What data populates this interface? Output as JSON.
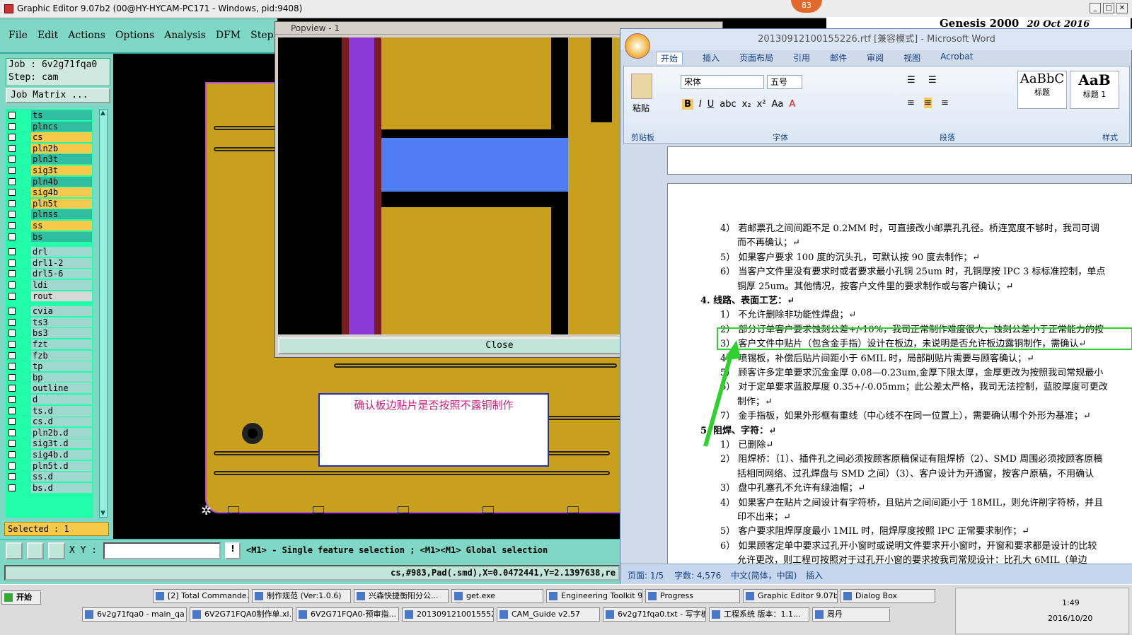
{
  "title": "Graphic Editor 9.07b2 (00@HY-HYCAM-PC171 - Windows, pid:9408)",
  "badge": "83",
  "genesis": {
    "name": "Genesis 2000",
    "date": "20 Oct 2016"
  },
  "menu": [
    "File",
    "Edit",
    "Actions",
    "Options",
    "Analysis",
    "DFM",
    "Step"
  ],
  "job": {
    "job": "Job : 6v2g71fqa0",
    "step": "Step: cam",
    "matrix": "Job Matrix ..."
  },
  "layers": [
    {
      "name": "ts",
      "color": "#2fbfa0"
    },
    {
      "name": "plncs",
      "color": "#2fbfa0"
    },
    {
      "name": "cs",
      "color": "#f5c94a"
    },
    {
      "name": "pln2b",
      "color": "#f5c94a"
    },
    {
      "name": "pln3t",
      "color": "#2fbfa0"
    },
    {
      "name": "sig3t",
      "color": "#f5c94a"
    },
    {
      "name": "pln4b",
      "color": "#2fbfa0"
    },
    {
      "name": "sig4b",
      "color": "#f5c94a"
    },
    {
      "name": "pln5t",
      "color": "#f5c94a"
    },
    {
      "name": "plnss",
      "color": "#2fbfa0"
    },
    {
      "name": "ss",
      "color": "#f5c94a"
    },
    {
      "name": "bs",
      "color": "#2fbfa0"
    },
    {
      "name": "drl",
      "color": "#9ed8cf"
    },
    {
      "name": "drl1-2",
      "color": "#9ed8cf"
    },
    {
      "name": "drl5-6",
      "color": "#9ed8cf"
    },
    {
      "name": "ldi",
      "color": "#9ed8cf"
    },
    {
      "name": "rout",
      "color": "#d8d8d8"
    },
    {
      "name": "cvia",
      "color": "#9ed8cf"
    },
    {
      "name": "ts3",
      "color": "#9ed8cf"
    },
    {
      "name": "bs3",
      "color": "#9ed8cf"
    },
    {
      "name": "fzt",
      "color": "#9ed8cf"
    },
    {
      "name": "fzb",
      "color": "#9ed8cf"
    },
    {
      "name": "tp",
      "color": "#9ed8cf"
    },
    {
      "name": "bp",
      "color": "#9ed8cf"
    },
    {
      "name": "outline",
      "color": "#9ed8cf"
    },
    {
      "name": "d",
      "color": "#9ed8cf"
    },
    {
      "name": "ts.d",
      "color": "#9ed8cf"
    },
    {
      "name": "cs.d",
      "color": "#9ed8cf"
    },
    {
      "name": "pln2b.d",
      "color": "#9ed8cf"
    },
    {
      "name": "sig3t.d",
      "color": "#9ed8cf"
    },
    {
      "name": "sig4b.d",
      "color": "#9ed8cf"
    },
    {
      "name": "pln5t.d",
      "color": "#9ed8cf"
    },
    {
      "name": "ss.d",
      "color": "#9ed8cf"
    },
    {
      "name": "bs.d",
      "color": "#9ed8cf"
    }
  ],
  "selected": "Selected : 1",
  "xy_label": "X Y :",
  "hint": "<M1> - Single feature selection ; <M1><M1> Global selection",
  "status": "cs,#983,Pad(.smd),X=0.0472441,Y=2.1397638,re",
  "popview": {
    "title": "Popview - 1",
    "close": "Close"
  },
  "note": "确认板边贴片是否按照不露铜制作",
  "word": {
    "title": "2013091210015522​6.rtf [兼容模式] - Microsoft Word",
    "tabs": [
      "开始",
      "插入",
      "页面布局",
      "引用",
      "邮件",
      "审阅",
      "视图",
      "Acrobat"
    ],
    "font": "宋体",
    "size": "五号",
    "groups": [
      "剪贴板",
      "字体",
      "段落",
      "样式"
    ],
    "paste": "粘贴",
    "styles": [
      "AaBbC",
      "AaB"
    ],
    "style_labels": [
      "标题",
      "标题 1"
    ],
    "lines": [
      "4） 若邮票孔之间间距不足 0.2MM 时，可直接改小邮票孔孔径。桥连宽度不够时，我司可调",
      "而不再确认；↵",
      "5） 如果客户要求 100 度的沉头孔，可默认按 90 度去制作；↵",
      "6） 当客户文件里没有要求时或者要求最小孔铜 25um 时，孔铜厚按 IPC 3 标标准控制，单点",
      "铜厚 25um。其他情况，按客户文件里的要求制作或与客户确认；↵",
      "4.  线路、表面工艺：↵",
      "1） 不允许删除非功能性焊盘；↵",
      "2） 部分订单客户要求蚀刻公差+/-10%，我司正常制作难度很大，蚀刻公差小于正常能力的按",
      "3） 客户文件中贴片（包含金手指）设计在板边，未说明是否允许板边露铜制作，需确认↵",
      "4） 喷锡板，补偿后贴片间距小于 6MIL 时，局部削贴片需要与顾客确认；↵",
      "5） 顾客许多定单要求沉金金厚 0.08—0.23um,金厚下限太厚，金厚更改为按照我司常规最小",
      "6） 对于定单要求蓝胶厚度 0.35+/-0.05mm；此公差太严格，我司无法控制，蓝胶厚度可更改",
      "制作；↵",
      "7） 金手指板，如果外形框有重线（中心线不在同一位置上），需要确认哪个外形为基准；↵",
      "5.  阻焊、字符：↵",
      "1） 已删除↵",
      "2） 阻焊桥：（1）、插件孔之间必须按顾客原稿保证有阻焊桥（2）、SMD 周围必须按顾客原稿",
      "括相同网络、过孔焊盘与 SMD 之间）（3）、客户设计为开通窗，按客户原稿，不用确认",
      "3） 盘中孔塞孔不允许有绿油帽；↵",
      "4） 如果客户在贴片之间设计有字符桥，且贴片之间间距小于 18MIL，则允许削字符桥，并且",
      "印不出来；↵",
      "5） 客户要求阻焊厚度最小 1MIL 时，阻焊厚度按照 IPC 正常要求制作；↵",
      "6） 如果顾客定单中要求过孔开小窗时或说明文件要求开小窗时，开窗和要求都是设计的比较",
      "允许更改，则工程可按照对于过孔开小窗的要求按我司常规设计：比孔大 6MIL（单边"
    ],
    "status": {
      "page": "页面: 1/5",
      "words": "字数: 4,576",
      "lang": "中文(简体，中国)",
      "mode": "插入"
    }
  },
  "taskbar": {
    "start": "开始",
    "row1": [
      "[2] Total Commande...",
      "制作规范 (Ver:1.0.6)",
      "兴森快捷衡阳分公...",
      "get.exe",
      "Engineering Toolkit 9...",
      "Progress",
      "Graphic Editor 9.07b...",
      "Dialog Box"
    ],
    "row2": [
      "6v2g71fqa0 - main_qa",
      "6V2G71FQA0制作单.xl...",
      "6V2G71FQA0-预审指...",
      "20130912100155522...",
      "CAM_Guide v2.57",
      "6v2g71fqa0.txt - 写字板",
      "工程系统  版本：1.1...",
      "周丹"
    ],
    "time": "1:49",
    "date": "2016/10/20"
  }
}
